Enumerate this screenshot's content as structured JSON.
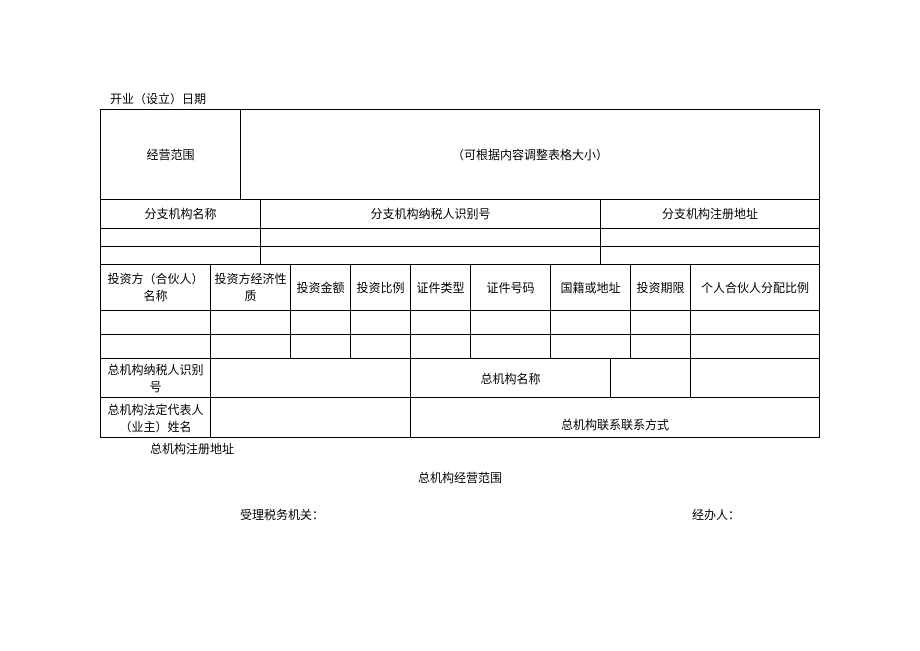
{
  "top_label": "开业（设立）日期",
  "table1": {
    "scope_label": "经营范围",
    "scope_note": "（可根据内容调整表格大小）"
  },
  "branch": {
    "col_name": "分支机构名称",
    "col_taxid": "分支机构纳税人识别号",
    "col_addr": "分支机构注册地址"
  },
  "investor": {
    "col_name": "投资方（合伙人）名称",
    "col_econ": "投资方经济性质",
    "col_amount": "投资金额",
    "col_ratio": "投资比例",
    "col_certtype": "证件类型",
    "col_certno": "证件号码",
    "col_nation": "国籍或地址",
    "col_period": "投资期限",
    "col_partner_ratio": "个人合伙人分配比例"
  },
  "hq": {
    "taxid_label": "总机构纳税人识别号",
    "name_label": "总机构名称",
    "legal_label": "总机构法定代表人（业主）姓名",
    "contact_label": "总机构联系联系方式",
    "addr_label": "总机构注册地址",
    "scope_label": "总机构经营范围"
  },
  "footer": {
    "accept_org": "受理税务机关：",
    "handler": "经办人："
  }
}
